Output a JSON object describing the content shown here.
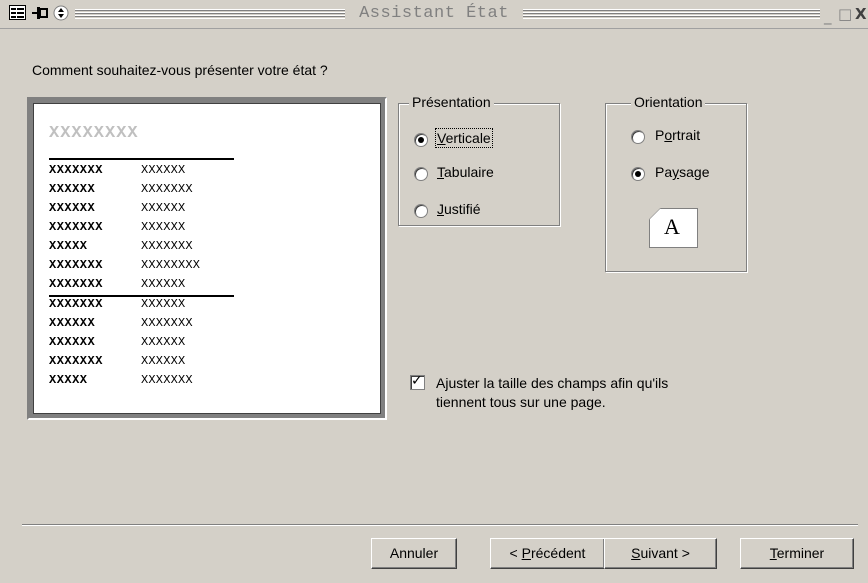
{
  "window": {
    "title": "Assistant État",
    "minimize": "_",
    "maximize": "□",
    "close": "X"
  },
  "question": "Comment souhaitez-vous présenter votre état ?",
  "preview": {
    "title": "XXXXXXXX",
    "rows": [
      [
        "XXXXXXX",
        "XXXXXX"
      ],
      [
        "XXXXXX",
        "XXXXXXX"
      ],
      [
        "XXXXXX",
        "XXXXXX"
      ],
      [
        "XXXXXXX",
        "XXXXXX"
      ],
      [
        "XXXXX",
        "XXXXXXX"
      ],
      [
        "XXXXXXX",
        "XXXXXXXX"
      ],
      [
        "XXXXXXX",
        "XXXXXX"
      ],
      [
        "XXXXXXX",
        "XXXXXX"
      ],
      [
        "XXXXXX",
        "XXXXXXX"
      ],
      [
        "XXXXXX",
        "XXXXXX"
      ],
      [
        "XXXXXXX",
        "XXXXXX"
      ],
      [
        "XXXXX",
        "XXXXXXX"
      ]
    ]
  },
  "presentation": {
    "label": "Présentation",
    "options": [
      {
        "before": "",
        "accel": "V",
        "after": "erticale",
        "selected": true
      },
      {
        "before": "",
        "accel": "T",
        "after": "abulaire",
        "selected": false
      },
      {
        "before": "",
        "accel": "J",
        "after": "ustifié",
        "selected": false
      }
    ]
  },
  "orientation": {
    "label": "Orientation",
    "options": [
      {
        "before": "P",
        "accel": "o",
        "after": "rtrait",
        "selected": false
      },
      {
        "before": "Pa",
        "accel": "y",
        "after": "sage",
        "selected": true
      }
    ],
    "page_letter": "A"
  },
  "fit_checkbox": {
    "checked": true,
    "line1_before": "A",
    "line1_accel": "j",
    "line1_after": "uster la taille des champs afin qu'ils",
    "line2": "tiennent tous sur une page."
  },
  "buttons": {
    "cancel": {
      "before": "Annuler",
      "accel": "",
      "after": ""
    },
    "previous": {
      "before": "< ",
      "accel": "P",
      "after": "récédent"
    },
    "next": {
      "before": "",
      "accel": "S",
      "after": "uivant >"
    },
    "finish": {
      "before": "",
      "accel": "T",
      "after": "erminer"
    }
  }
}
